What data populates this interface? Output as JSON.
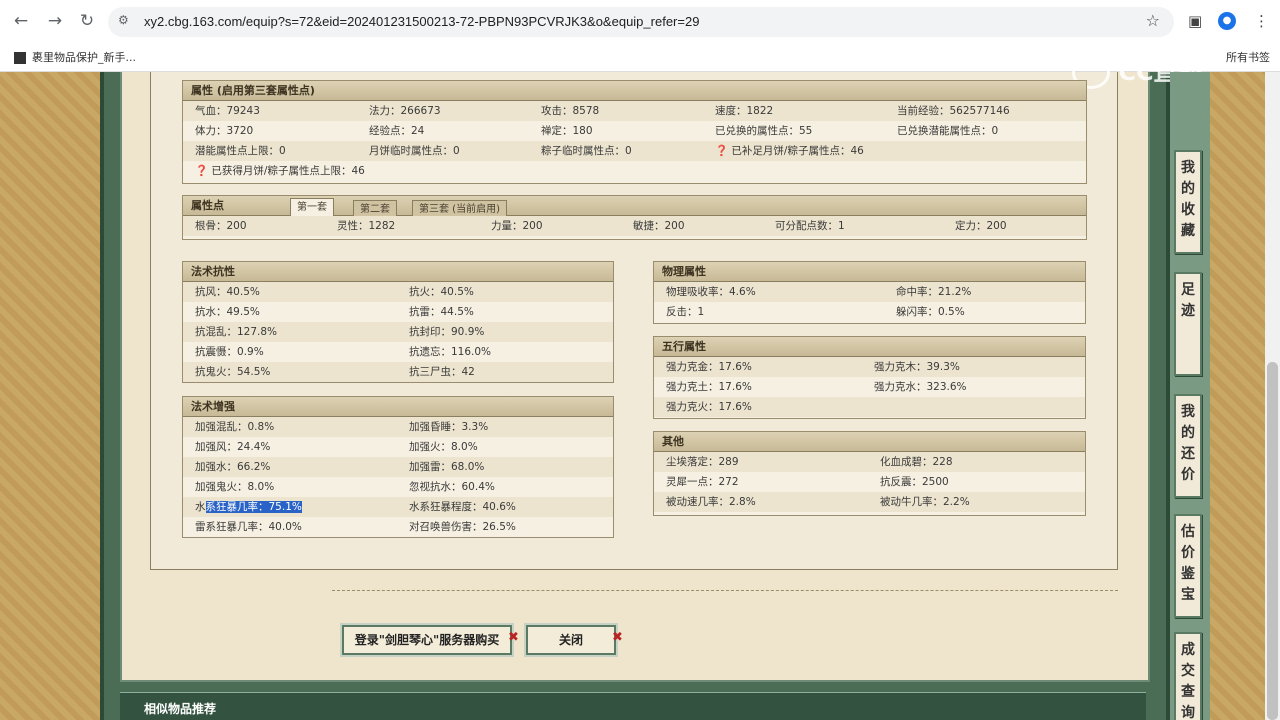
{
  "browser": {
    "url": "xy2.cbg.163.com/equip?s=72&eid=202401231500213-72-PBPN93PCVRJK3&o&equip_refer=29",
    "bookmark": "裹里物品保护_新手...",
    "bookmarks_right": "所有书签",
    "back_icon": "←",
    "forward_icon": "→",
    "reload_icon": "↻",
    "site_icon": "⚙",
    "star_icon": "☆"
  },
  "attrs": {
    "title": "属性 (启用第三套属性点)",
    "rows": [
      [
        "气血：79243",
        "法力：266673",
        "攻击：8578",
        "速度：1822",
        "当前经验：562577146"
      ],
      [
        "体力：3720",
        "经验点：24",
        "禅定：180",
        "已兑换的属性点：55",
        "已兑换潜能属性点：0"
      ],
      [
        "潜能属性点上限：0",
        "月饼临时属性点：0",
        "粽子临时属性点：0",
        "❓ 已补足月饼/粽子属性点：46",
        ""
      ],
      [
        "❓ 已获得月饼/粽子属性点上限：46",
        "",
        "",
        "",
        ""
      ]
    ]
  },
  "points": {
    "title": "属性点",
    "tabs": [
      "第一套",
      "第二套",
      "第三套 (当前启用)"
    ],
    "values": [
      "根骨：200",
      "灵性：1282",
      "力量：200",
      "敏捷：200",
      "可分配点数：1",
      "定力：200"
    ]
  },
  "resist": {
    "title": "法术抗性",
    "rows": [
      [
        "抗风：40.5%",
        "抗火：40.5%"
      ],
      [
        "抗水：49.5%",
        "抗雷：44.5%"
      ],
      [
        "抗混乱：127.8%",
        "抗封印：90.9%"
      ],
      [
        "抗震慑：0.9%",
        "抗遗忘：116.0%"
      ],
      [
        "抗鬼火：54.5%",
        "抗三尸虫：42"
      ]
    ]
  },
  "enhance": {
    "title": "法术增强",
    "rows": [
      [
        "加强混乱：0.8%",
        "加强昏睡：3.3%"
      ],
      [
        "加强风：24.4%",
        "加强火：8.0%"
      ],
      [
        "加强水：66.2%",
        "加强雷：68.0%"
      ],
      [
        "加强鬼火：8.0%",
        "忽视抗水：60.4%"
      ],
      [
        "水系狂暴几率：75.1%",
        "水系狂暴程度：40.6%"
      ],
      [
        "雷系狂暴几率：40.0%",
        "对召唤兽伤害：26.5%"
      ]
    ]
  },
  "physical": {
    "title": "物理属性",
    "rows": [
      [
        "物理吸收率：4.6%",
        "命中率：21.2%"
      ],
      [
        "反击：1",
        "躲闪率：0.5%"
      ]
    ]
  },
  "wuxing": {
    "title": "五行属性",
    "rows": [
      [
        "强力克金：17.6%",
        "强力克木：39.3%"
      ],
      [
        "强力克土：17.6%",
        "强力克水：323.6%"
      ],
      [
        "强力克火：17.6%",
        ""
      ]
    ]
  },
  "other": {
    "title": "其他",
    "rows": [
      [
        "尘埃落定：289",
        "化血成碧：228"
      ],
      [
        "灵犀一点：272",
        "抗反震：2500"
      ],
      [
        "被动速几率：2.8%",
        "被动牛几率：2.2%"
      ]
    ]
  },
  "buttons": {
    "buy": "登录\"剑胆琴心\"服务器购买",
    "close": "关闭"
  },
  "similar": "相似物品推荐",
  "side_tabs": [
    "我的收藏",
    "足迹",
    "我的还价",
    "估价鉴宝",
    "成交查询"
  ],
  "logo_text": "CC直播"
}
